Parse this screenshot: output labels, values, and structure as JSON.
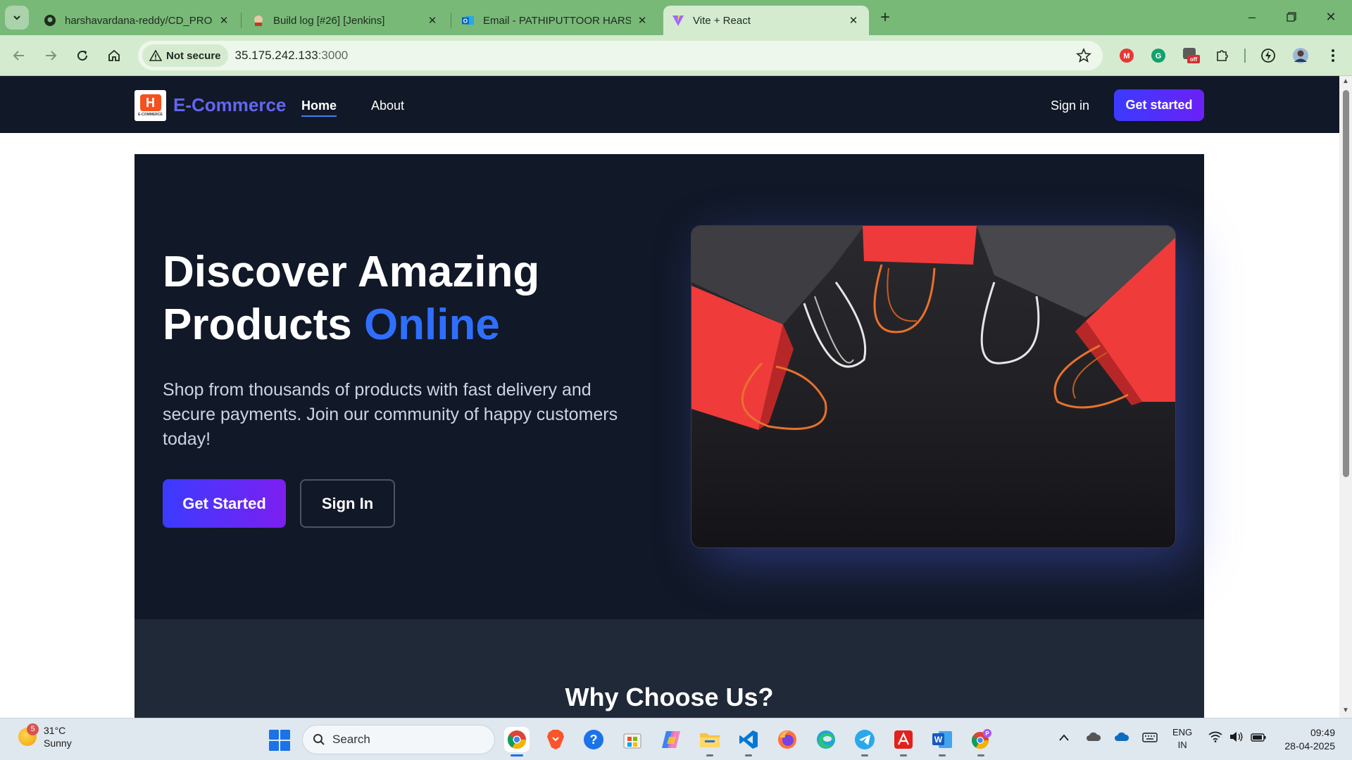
{
  "browser": {
    "tabs": [
      {
        "label": "harshavardana-reddy/CD_PROJ",
        "icon": "github-icon",
        "active": false
      },
      {
        "label": "Build log [#26] [Jenkins]",
        "icon": "jenkins-icon",
        "active": false
      },
      {
        "label": "Email - PATHIPUTTOOR HARSH",
        "icon": "outlook-icon",
        "active": false
      },
      {
        "label": "Vite + React",
        "icon": "vite-icon",
        "active": true
      }
    ],
    "security_label": "Not secure",
    "url_host": "35.175.242.133",
    "url_port": ":3000"
  },
  "site": {
    "brand": "E-Commerce",
    "logo_letter": "H",
    "logo_caption": "E-COMMERCE",
    "nav": {
      "home": "Home",
      "about": "About",
      "signin": "Sign in",
      "cta": "Get started"
    },
    "hero": {
      "title_line1": "Discover Amazing",
      "title_line2_plain": "Products ",
      "title_line2_accent": "Online",
      "text": "Shop from thousands of products with fast delivery and secure payments. Join our community of happy customers today!",
      "primary_button": "Get Started",
      "secondary_button": "Sign In"
    },
    "why_title": "Why Choose Us?"
  },
  "taskbar": {
    "weather_temp": "31°C",
    "weather_desc": "Sunny",
    "weather_badge": "5",
    "search_placeholder": "Search",
    "lang_line1": "ENG",
    "lang_line2": "IN",
    "time": "09:49",
    "date": "28-04-2025"
  },
  "colors": {
    "accent": "#2f6fff",
    "brand": "#6366f1",
    "nav_bg": "#111827",
    "chrome_green": "#78b978"
  }
}
